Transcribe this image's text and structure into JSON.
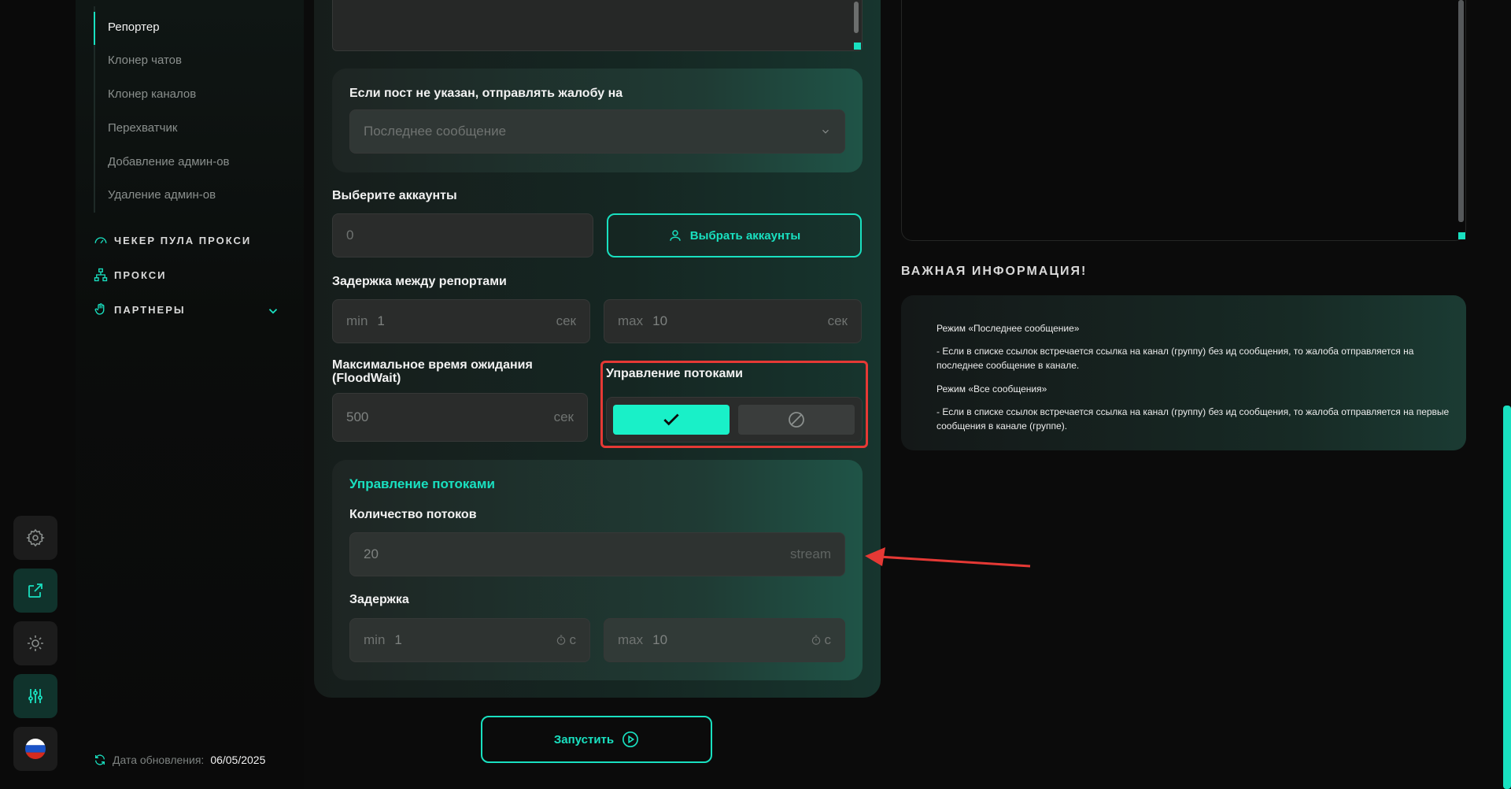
{
  "sidebar": {
    "subitems": [
      "Репортер",
      "Клонер чатов",
      "Клонер каналов",
      "Перехватчик",
      "Добавление админ-ов",
      "Удаление админ-ов"
    ],
    "nav": [
      "ЧЕКЕР ПУЛА ПРОКСИ",
      "ПРОКСИ",
      "ПАРТНЕРЫ"
    ],
    "update_label": "Дата обновления:",
    "update_date": "06/05/2025"
  },
  "rail": {
    "icons": [
      "gear-icon",
      "external-link-icon",
      "sun-icon",
      "sliders-icon",
      "russia-flag-icon"
    ]
  },
  "form": {
    "fallback_label": "Если пост не указан, отправлять жалобу на",
    "fallback_value": "Последнее сообщение",
    "accounts_label": "Выберите аккаунты",
    "accounts_value": "0",
    "accounts_button": "Выбрать аккаунты",
    "delay_label": "Задержка между репортами",
    "delay_min_prefix": "min",
    "delay_min_value": "1",
    "delay_max_prefix": "max",
    "delay_max_value": "10",
    "unit_sec": "сек",
    "floodwait_label_1": "Максимальное время ожидания",
    "floodwait_label_2": "(FloodWait)",
    "floodwait_value": "500",
    "threads_toggle_label": "Управление потоками",
    "threads_card_title": "Управление потоками",
    "thread_count_label": "Количество потоков",
    "thread_count_value": "20",
    "thread_count_unit": "stream",
    "thread_delay_label": "Задержка",
    "thread_delay_min_prefix": "min",
    "thread_delay_min_value": "1",
    "thread_delay_max_prefix": "max",
    "thread_delay_max_value": "10",
    "thread_delay_unit": "с",
    "run_button": "Запустить"
  },
  "info": {
    "heading": "ВАЖНАЯ ИНФОРМАЦИЯ!",
    "mode1_title": "Режим «Последнее сообщение»",
    "mode1_text": "- Если в списке ссылок встречается ссылка на канал (группу) без ид сообщения, то жалоба отправляется на последнее сообщение в канале.",
    "mode2_title": "Режим «Все сообщения»",
    "mode2_text": "- Если в списке ссылок встречается ссылка на канал (группу) без ид сообщения, то жалоба отправляется на первые сообщения в канале (группе)."
  },
  "colors": {
    "accent": "#19e0c0",
    "highlight_red": "#e53935"
  }
}
